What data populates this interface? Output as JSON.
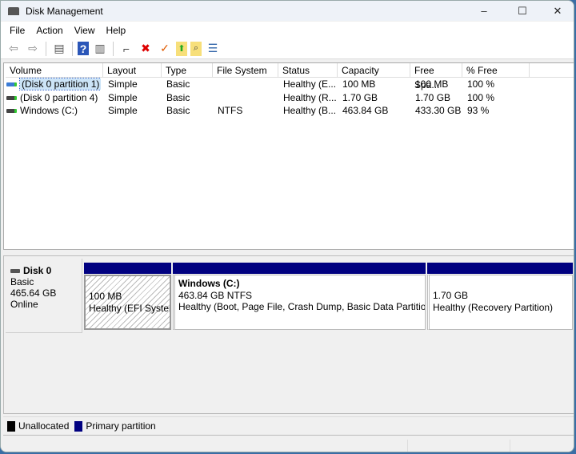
{
  "window": {
    "title": "Disk Management",
    "minimize": "–",
    "maximize": "☐",
    "close": "✕"
  },
  "menu": [
    "File",
    "Action",
    "View",
    "Help"
  ],
  "toolbar": [
    {
      "name": "back-icon",
      "glyph": "⇦",
      "color": "#888"
    },
    {
      "name": "forward-icon",
      "glyph": "⇨",
      "color": "#888"
    },
    {
      "name": "show-hide-console-tree-icon",
      "glyph": "▤",
      "color": "#555"
    },
    {
      "name": "help-icon",
      "glyph": "?",
      "color": "#fff"
    },
    {
      "name": "show-hide-action-pane-icon",
      "glyph": "▥",
      "color": "#555"
    },
    {
      "name": "connect-drive-icon",
      "glyph": "⌐",
      "color": "#444"
    },
    {
      "name": "delete-icon",
      "glyph": "✖",
      "color": "#d00"
    },
    {
      "name": "properties-icon",
      "glyph": "✓",
      "color": "#e05a00"
    },
    {
      "name": "import-icon",
      "glyph": "⬆",
      "color": "#2a2"
    },
    {
      "name": "search-icon",
      "glyph": "⌕",
      "color": "#444"
    },
    {
      "name": "list-view-icon",
      "glyph": "☰",
      "color": "#36a"
    }
  ],
  "columns": [
    "Volume",
    "Layout",
    "Type",
    "File System",
    "Status",
    "Capacity",
    "Free Spa...",
    "% Free"
  ],
  "volumes": [
    {
      "volume": "(Disk 0 partition 1)",
      "layout": "Simple",
      "type": "Basic",
      "fs": "",
      "status": "Healthy (E...",
      "capacity": "100 MB",
      "free": "100 MB",
      "pct": "100 %"
    },
    {
      "volume": "(Disk 0 partition 4)",
      "layout": "Simple",
      "type": "Basic",
      "fs": "",
      "status": "Healthy (R...",
      "capacity": "1.70 GB",
      "free": "1.70 GB",
      "pct": "100 %"
    },
    {
      "volume": "Windows (C:)",
      "layout": "Simple",
      "type": "Basic",
      "fs": "NTFS",
      "status": "Healthy (B...",
      "capacity": "463.84 GB",
      "free": "433.30 GB",
      "pct": "93 %"
    }
  ],
  "disk": {
    "name": "Disk 0",
    "type": "Basic",
    "size": "465.64 GB",
    "state": "Online"
  },
  "partitions": [
    {
      "title": "",
      "size": "100 MB",
      "status": "Healthy (EFI System Partition)"
    },
    {
      "title": "Windows  (C:)",
      "size": "463.84 GB NTFS",
      "status": "Healthy (Boot, Page File, Crash Dump, Basic Data Partition)"
    },
    {
      "title": "",
      "size": "1.70 GB",
      "status": "Healthy (Recovery Partition)"
    }
  ],
  "legend": [
    {
      "label": "Unallocated",
      "color": "#000000"
    },
    {
      "label": "Primary partition",
      "color": "#000080"
    }
  ]
}
